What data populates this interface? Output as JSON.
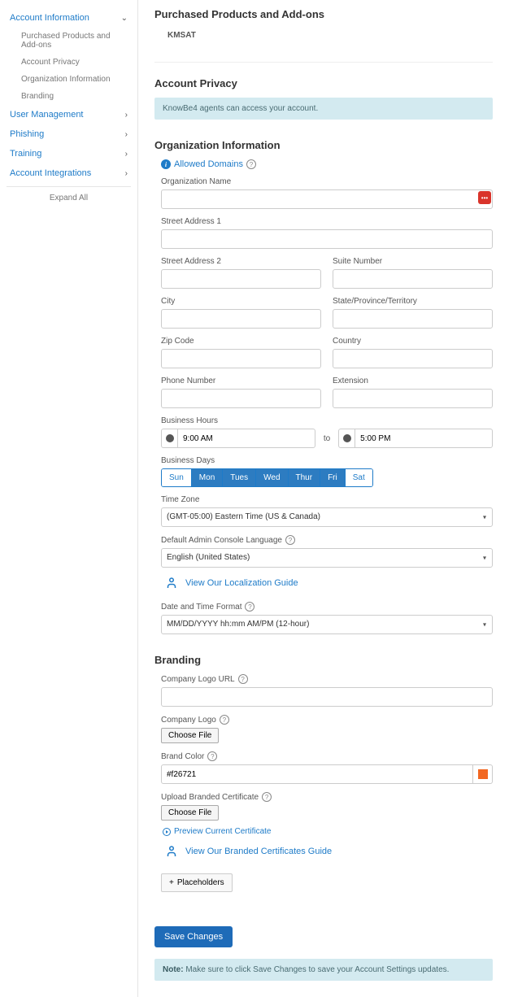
{
  "sidebar": {
    "items": [
      {
        "label": "Account Information",
        "expanded": true
      },
      {
        "label": "User Management",
        "expanded": false
      },
      {
        "label": "Phishing",
        "expanded": false
      },
      {
        "label": "Training",
        "expanded": false
      },
      {
        "label": "Account Integrations",
        "expanded": false
      }
    ],
    "sub_items": [
      "Purchased Products and Add-ons",
      "Account Privacy",
      "Organization Information",
      "Branding"
    ],
    "expand_all": "Expand All"
  },
  "purchased": {
    "title": "Purchased Products and Add-ons",
    "product": "KMSAT"
  },
  "privacy": {
    "title": "Account Privacy",
    "banner": "KnowBe4 agents can access your account."
  },
  "org": {
    "title": "Organization Information",
    "allowed_domains": "Allowed Domains",
    "fields": {
      "org_name": "Organization Name",
      "street1": "Street Address 1",
      "street2": "Street Address 2",
      "suite": "Suite Number",
      "city": "City",
      "state": "State/Province/Territory",
      "zip": "Zip Code",
      "country": "Country",
      "phone": "Phone Number",
      "ext": "Extension",
      "hours": "Business Hours",
      "hours_from": "9:00 AM",
      "to": "to",
      "hours_to": "5:00 PM",
      "days": "Business Days",
      "timezone": "Time Zone",
      "timezone_val": "(GMT-05:00) Eastern Time (US & Canada)",
      "lang": "Default Admin Console Language",
      "lang_val": "English (United States)",
      "loc_guide": "View Our Localization Guide",
      "datetime": "Date and Time Format",
      "datetime_val": "MM/DD/YYYY hh:mm AM/PM (12-hour)"
    },
    "days_list": [
      "Sun",
      "Mon",
      "Tues",
      "Wed",
      "Thur",
      "Fri",
      "Sat"
    ],
    "days_active": [
      false,
      true,
      true,
      true,
      true,
      true,
      false
    ]
  },
  "branding": {
    "title": "Branding",
    "logo_url": "Company Logo URL",
    "logo": "Company Logo",
    "choose_file": "Choose File",
    "color": "Brand Color",
    "color_val": "#f26721",
    "cert": "Upload Branded Certificate",
    "preview_cert": "Preview Current Certificate",
    "cert_guide": "View Our Branded Certificates Guide",
    "placeholders": "Placeholders"
  },
  "save": "Save Changes",
  "note_bold": "Note:",
  "note": " Make sure to click Save Changes to save your Account Settings updates."
}
